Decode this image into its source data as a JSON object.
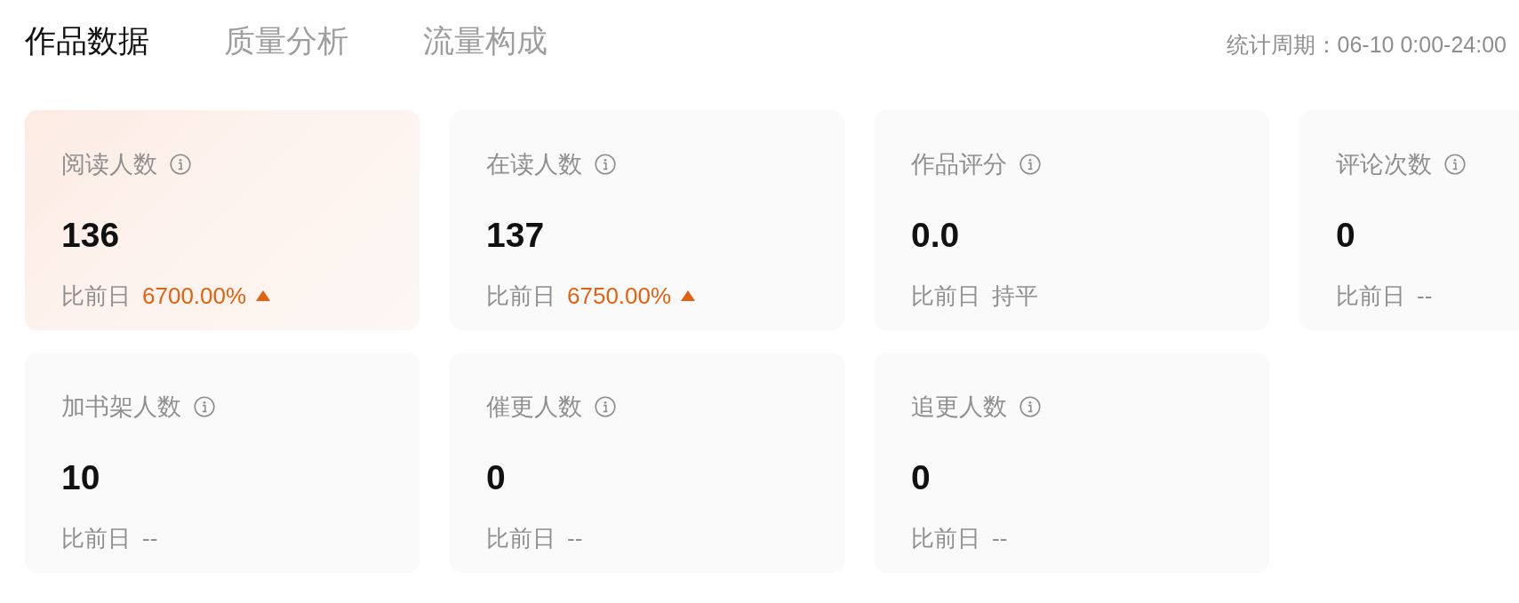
{
  "tabs": [
    {
      "label": "作品数据",
      "selected": true
    },
    {
      "label": "质量分析",
      "selected": false
    },
    {
      "label": "流量构成",
      "selected": false
    }
  ],
  "period": "统计周期：06-10 0:00-24:00",
  "cards": [
    {
      "label": "阅读人数",
      "value": "136",
      "compare_label": "比前日",
      "change": "6700.00%",
      "increased": true,
      "selected": true
    },
    {
      "label": "在读人数",
      "value": "137",
      "compare_label": "比前日",
      "change": "6750.00%",
      "increased": true,
      "selected": false
    },
    {
      "label": "作品评分",
      "value": "0.0",
      "compare_label": "比前日",
      "change": "持平",
      "increased": false,
      "selected": false
    },
    {
      "label": "评论次数",
      "value": "0",
      "compare_label": "比前日",
      "change": "--",
      "increased": false,
      "selected": false
    },
    {
      "label": "加书架人数",
      "value": "10",
      "compare_label": "比前日",
      "change": "--",
      "increased": false,
      "selected": false
    },
    {
      "label": "催更人数",
      "value": "0",
      "compare_label": "比前日",
      "change": "--",
      "increased": false,
      "selected": false
    },
    {
      "label": "追更人数",
      "value": "0",
      "compare_label": "比前日",
      "change": "--",
      "increased": false,
      "selected": false
    }
  ]
}
